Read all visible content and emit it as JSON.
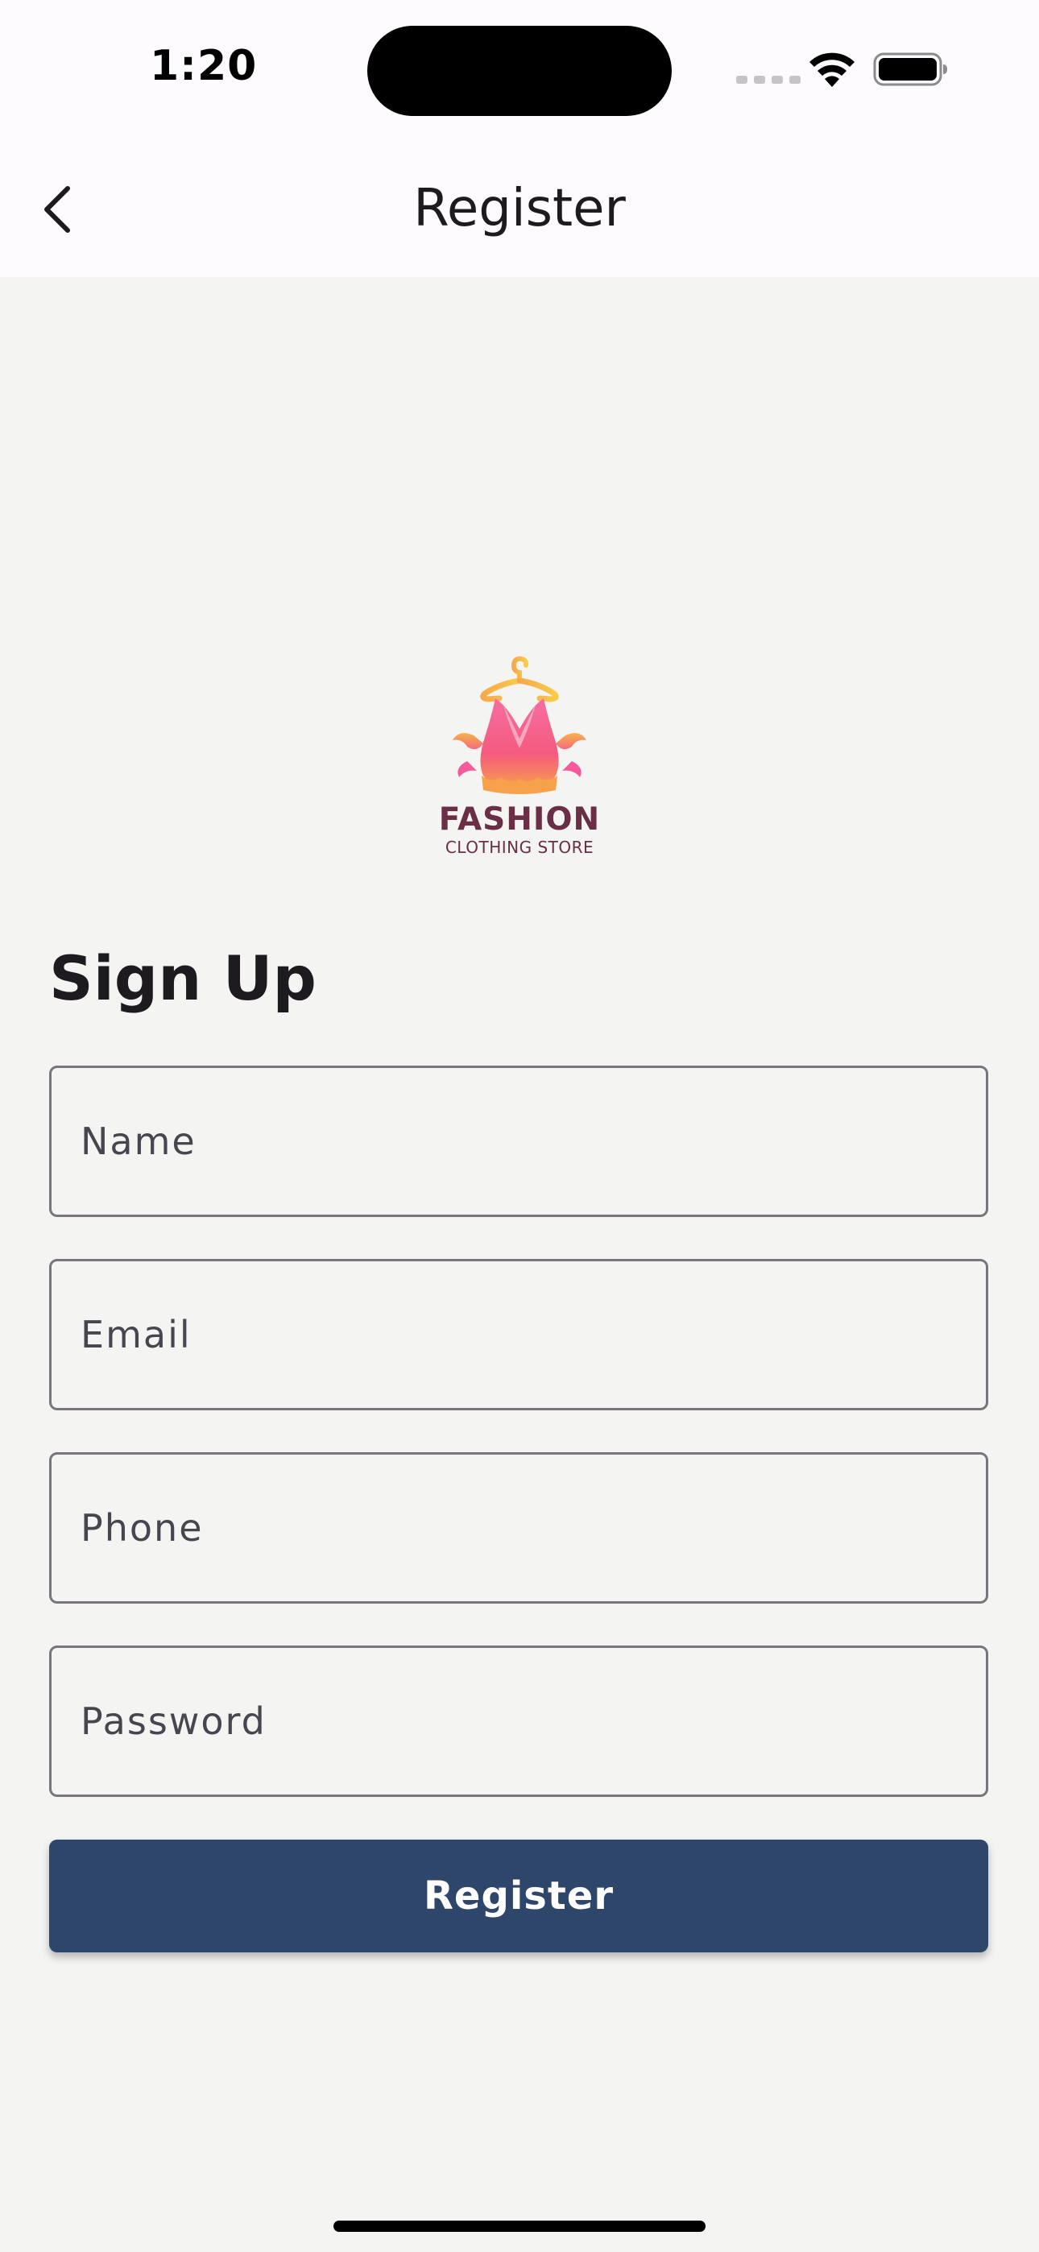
{
  "status_bar": {
    "time": "1:20"
  },
  "app_bar": {
    "title": "Register",
    "back_icon": "chevron-left-icon"
  },
  "logo": {
    "word": "FASHION",
    "subtitle": "CLOTHING STORE",
    "colors": {
      "primary": "#6a2f47",
      "gradient_top": "#f7c24b",
      "gradient_bottom": "#f0457f"
    }
  },
  "form": {
    "title": "Sign Up",
    "fields": {
      "name_placeholder": "Name",
      "email_placeholder": "Email",
      "phone_placeholder": "Phone",
      "password_placeholder": "Password"
    },
    "submit_label": "Register"
  },
  "colors": {
    "background": "#f4f4f3",
    "app_bar": "#fefbff",
    "button": "#2e4669",
    "field_border": "#79747e"
  }
}
